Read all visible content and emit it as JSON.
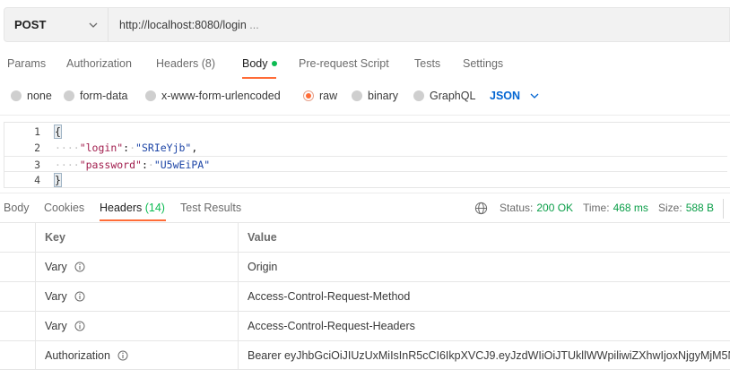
{
  "request": {
    "method": "POST",
    "url": "http://localhost:8080/login",
    "url_ellipsis": "..."
  },
  "request_tabs": [
    {
      "label": "Params"
    },
    {
      "label": "Authorization"
    },
    {
      "label": "Headers",
      "count": "(8)"
    },
    {
      "label": "Body",
      "active": true,
      "has_dot": true
    },
    {
      "label": "Pre-request Script"
    },
    {
      "label": "Tests"
    },
    {
      "label": "Settings"
    }
  ],
  "body_types": [
    {
      "label": "none",
      "selected": false
    },
    {
      "label": "form-data",
      "selected": false
    },
    {
      "label": "x-www-form-urlencoded",
      "selected": false
    },
    {
      "label": "raw",
      "selected": true
    },
    {
      "label": "binary",
      "selected": false
    },
    {
      "label": "GraphQL",
      "selected": false
    }
  ],
  "body_format": "JSON",
  "editor": {
    "lines": [
      {
        "num": "1",
        "text": "{"
      },
      {
        "num": "2",
        "key": "\"login\"",
        "colon": ":",
        "value": "\"SRIeYjb\"",
        "comma": ","
      },
      {
        "num": "3",
        "key": "\"password\"",
        "colon": ":",
        "value": "\"U5wEiPA\""
      },
      {
        "num": "4",
        "text": "}"
      }
    ],
    "whitespace_marker": "····"
  },
  "response_tabs": [
    {
      "label": "Body"
    },
    {
      "label": "Cookies"
    },
    {
      "label": "Headers",
      "count": "(14)",
      "active": true
    },
    {
      "label": "Test Results"
    }
  ],
  "response_status": {
    "status_label": "Status:",
    "status_value": "200 OK",
    "time_label": "Time:",
    "time_value": "468 ms",
    "size_label": "Size:",
    "size_value": "588 B"
  },
  "headers_table": {
    "columns": [
      "Key",
      "Value"
    ],
    "rows": [
      {
        "key": "Vary",
        "value": "Origin"
      },
      {
        "key": "Vary",
        "value": "Access-Control-Request-Method"
      },
      {
        "key": "Vary",
        "value": "Access-Control-Request-Headers"
      },
      {
        "key": "Authorization",
        "value": "Bearer eyJhbGciOiJIUzUxMiIsInR5cCI6IkpXVCJ9.eyJzdWIiOiJTUkllWWpiliwiZXhwIjoxNjgyMjM5N"
      }
    ]
  },
  "colors": {
    "accent": "#ff6c37",
    "active_dot": "#0cbb52",
    "link_blue": "#0265d2",
    "status_green": "#0a9e48"
  }
}
